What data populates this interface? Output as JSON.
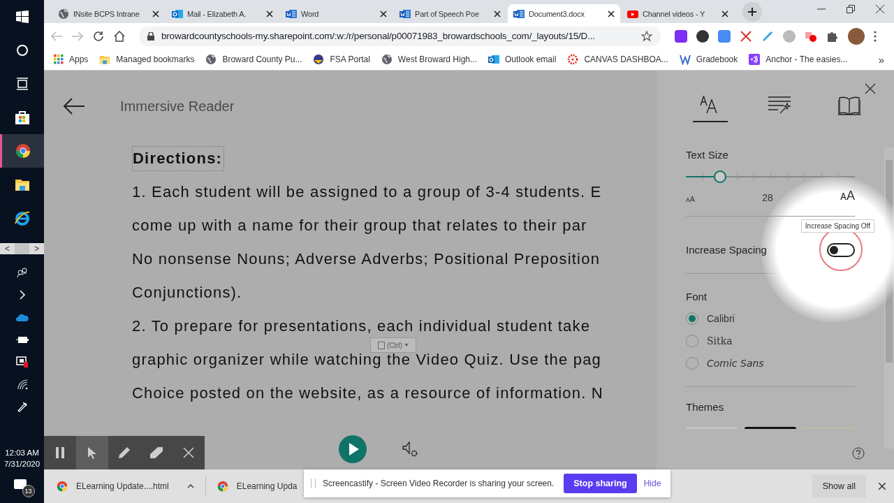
{
  "taskbar": {
    "apps": [
      {
        "kind": "windows",
        "selected": false
      },
      {
        "kind": "search",
        "selected": false
      },
      {
        "kind": "taskview",
        "selected": false
      },
      {
        "kind": "store",
        "selected": false
      },
      {
        "kind": "chrome",
        "selected": true
      },
      {
        "kind": "folder",
        "selected": false
      },
      {
        "kind": "ie",
        "selected": false
      }
    ],
    "scroll_left": "<",
    "scroll_right": ">",
    "tray": [
      {
        "kind": "people"
      },
      {
        "kind": "chevron"
      },
      {
        "kind": "cloud"
      },
      {
        "kind": "battery"
      },
      {
        "kind": "alert"
      },
      {
        "kind": "wifi"
      },
      {
        "kind": "pen"
      }
    ],
    "time": "12:03 AM",
    "date": "7/31/2020",
    "notification_count": "13"
  },
  "browser": {
    "tabs": [
      {
        "title": "INsite BCPS Intrane",
        "kind": "globe",
        "selected": false
      },
      {
        "title": "Mail - Elizabeth A.",
        "kind": "outlook",
        "selected": false
      },
      {
        "title": "Word",
        "kind": "word",
        "selected": false
      },
      {
        "title": "Part of Speech Poe",
        "kind": "word",
        "selected": false
      },
      {
        "title": "Document3.docx",
        "kind": "word",
        "selected": true
      },
      {
        "title": "Channel videos - Y",
        "kind": "youtube",
        "selected": false
      }
    ],
    "address": "browardcountyschools-my.sharepoint.com/:w:/r/personal/p00071983_browardschools_com/_layouts/15/D...",
    "bookmarks": [
      {
        "label": "Apps",
        "kind": "apps"
      },
      {
        "label": "Managed bookmarks",
        "kind": "folder"
      },
      {
        "label": "Broward County Pu...",
        "kind": "globe"
      },
      {
        "label": "FSA Portal",
        "kind": "fsa"
      },
      {
        "label": "West Broward High...",
        "kind": "globe"
      },
      {
        "label": "Outlook email",
        "kind": "outlook"
      },
      {
        "label": "CANVAS DASHBOA...",
        "kind": "canvas"
      },
      {
        "label": "Gradebook",
        "kind": "w"
      },
      {
        "label": "Anchor - The easies...",
        "kind": "anchor"
      }
    ],
    "more": "»"
  },
  "reader": {
    "title": "Immersive Reader",
    "heading": "Directions:",
    "lines": [
      "1. Each student will be assigned to a group of 3-4 students. E",
      "come up with a name for their group that relates to their par",
      "No nonsense Nouns; Adverse Adverbs; Positional Preposition",
      "Conjunctions).",
      "2. To prepare for presentations, each individual student take",
      "graphic organizer while watching the Video Quiz. Use the pag",
      "Choice posted on the website, as a resource of information. N"
    ],
    "paste_tag": "(Ctrl)"
  },
  "panel": {
    "tabs": [
      {
        "kind": "text",
        "selected": true
      },
      {
        "kind": "grammar",
        "selected": false
      },
      {
        "kind": "book",
        "selected": false
      }
    ],
    "text_size": {
      "label": "Text Size",
      "level": 0.2,
      "value": "28",
      "small_label": "ᴀA",
      "large_label": "ᴀA"
    },
    "spacing": {
      "label": "Increase Spacing",
      "on": false,
      "tooltip": "Increase Spacing Off"
    },
    "font": {
      "label": "Font",
      "options": [
        {
          "label": "Calibri",
          "kind": "sans",
          "selected": true
        },
        {
          "label": "Sitka",
          "kind": "serif",
          "selected": false
        },
        {
          "label": "Comic Sans",
          "kind": "comic",
          "selected": false
        }
      ]
    },
    "themes": {
      "label": "Themes"
    }
  },
  "recorder_tools": [
    {
      "kind": "pause",
      "selected": false
    },
    {
      "kind": "pointer",
      "selected": true
    },
    {
      "kind": "pencil",
      "selected": false
    },
    {
      "kind": "eraser",
      "selected": false
    },
    {
      "kind": "close",
      "selected": false
    }
  ],
  "downloads": {
    "items": [
      "ELearning Update....html",
      "ELearning Upda"
    ],
    "show_all": "Show all"
  },
  "sharing": {
    "message": "Screencastify - Screen Video Recorder is sharing your screen.",
    "stop": "Stop sharing",
    "hide": "Hide"
  }
}
